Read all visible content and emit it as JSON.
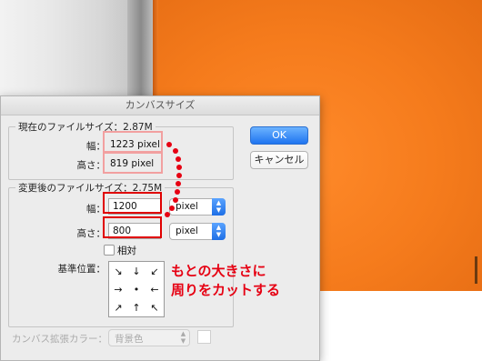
{
  "dialog": {
    "title": "カンバスサイズ",
    "current": {
      "group_title": "現在のファイルサイズ：2.87M",
      "width_label": "幅：",
      "width_value": "1223 pixel",
      "height_label": "高さ：",
      "height_value": "819 pixel"
    },
    "new": {
      "group_title": "変更後のファイルサイズ：2.75M",
      "width_label": "幅：",
      "width_value": "1200",
      "width_unit": "pixel",
      "height_label": "高さ：",
      "height_value": "800",
      "height_unit": "pixel",
      "relative_label": "相対",
      "anchor_label": "基準位置：",
      "anchor_arrows": [
        "↘",
        "↓",
        "↙",
        "→",
        "•",
        "←",
        "↗",
        "↑",
        "↖"
      ]
    },
    "extension": {
      "label": "カンバス拡張カラー：",
      "value": "背景色"
    },
    "ok_label": "OK",
    "cancel_label": "キャンセル"
  },
  "annotation": {
    "line1": "もとの大きさに",
    "line2": "周りをカットする",
    "color": "#e60012"
  }
}
